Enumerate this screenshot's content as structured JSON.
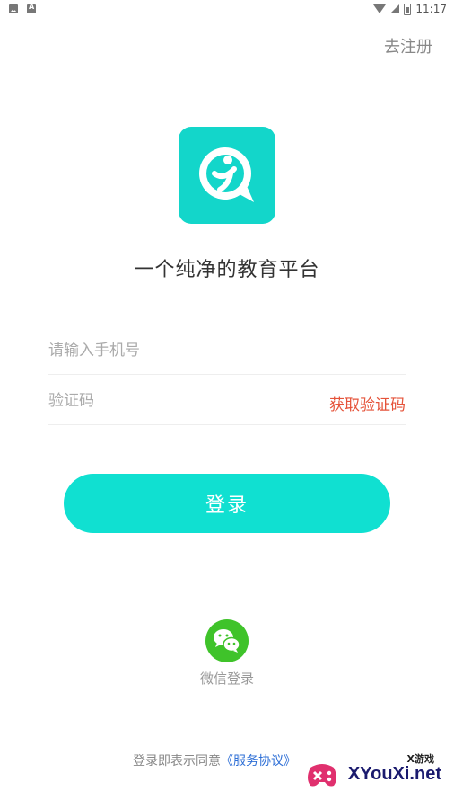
{
  "status_bar": {
    "time": "11:17"
  },
  "header": {
    "register_label": "去注册"
  },
  "brand": {
    "slogan": "一个纯净的教育平台",
    "logo_color": "#13d6ca"
  },
  "form": {
    "phone_placeholder": "请输入手机号",
    "code_placeholder": "验证码",
    "get_code_label": "获取验证码"
  },
  "login": {
    "label": "登录",
    "color": "#10e0d1"
  },
  "wechat": {
    "label": "微信登录",
    "color": "#3fc32a"
  },
  "agreement": {
    "prefix": "登录即表示同意",
    "link": "《服务协议》"
  },
  "watermark": {
    "top_label": "X游戏",
    "site": "XYouXi.net"
  }
}
